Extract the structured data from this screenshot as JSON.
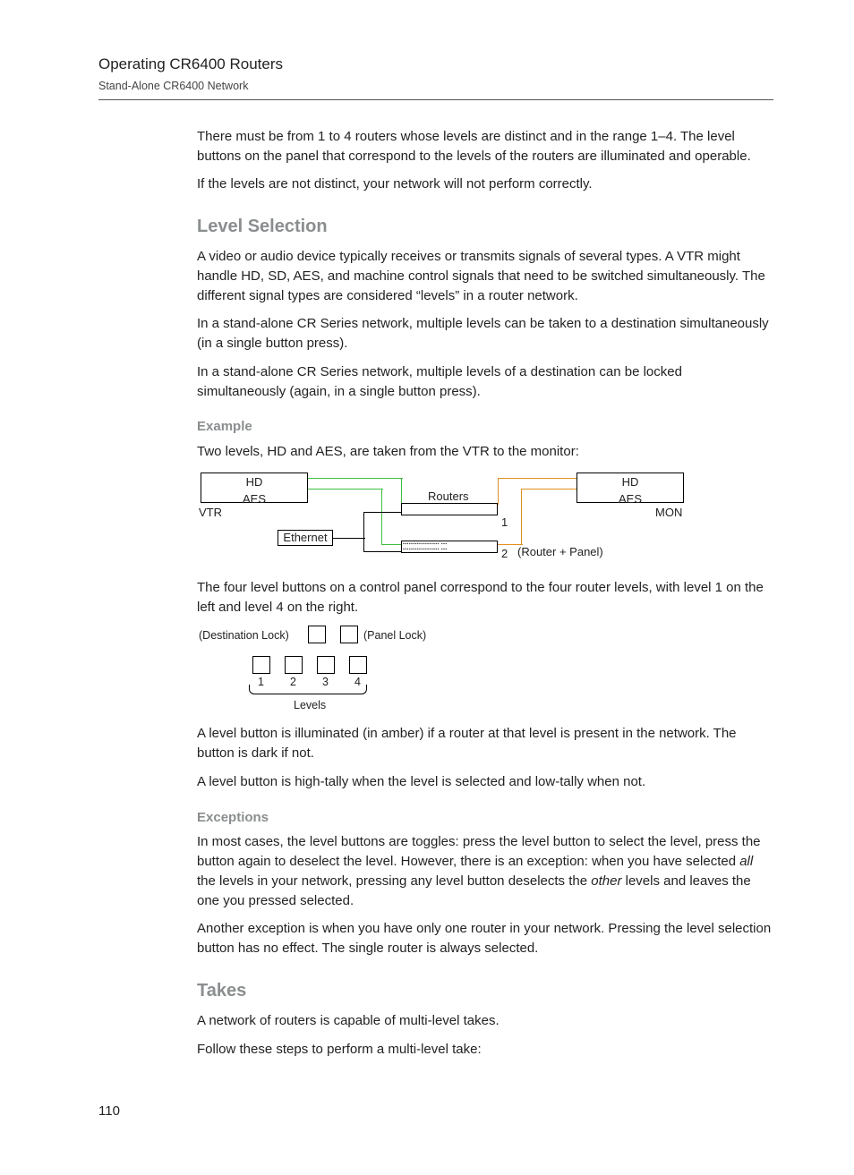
{
  "header": {
    "title": "Operating CR6400 Routers",
    "subtitle": "Stand-Alone CR6400 Network"
  },
  "intro": {
    "p1": "There must be from 1 to 4 routers whose levels are distinct and in the range 1–4. The level buttons on the panel that correspond to the levels of the routers are illuminated and operable.",
    "p2": "If the levels are not distinct, your network will not perform correctly."
  },
  "level_selection": {
    "heading": "Level Selection",
    "p1": "A video or audio device typically receives or transmits signals of several types. A VTR might handle HD, SD, AES, and machine control signals that need to be switched simultaneously. The different signal types are considered “levels” in a router network.",
    "p2": "In a stand-alone CR Series network, multiple levels can be taken to a destination simultaneously (in a single button press).",
    "p3": "In a stand-alone CR Series network, multiple levels of a destination can be locked simultaneously (again, in a single button press)."
  },
  "example": {
    "heading": "Example",
    "intro": "Two levels, HD and AES, are taken from the VTR to the monitor:",
    "diagram1": {
      "vtr_line1": "HD",
      "vtr_line2": "AES",
      "vtr_label": "VTR",
      "mon_line1": "HD",
      "mon_line2": "AES",
      "mon_label": "MON",
      "routers_label": "Routers",
      "ethernet_label": "Ethernet",
      "router_panel_label": "(Router + Panel)",
      "num1": "1",
      "num2": "2"
    },
    "after1": "The four level buttons on a control panel correspond to the four router levels, with level 1 on the left and level 4 on the right.",
    "diagram2": {
      "dest_lock": "(Destination Lock)",
      "panel_lock": "(Panel Lock)",
      "levels_label": "Levels",
      "n1": "1",
      "n2": "2",
      "n3": "3",
      "n4": "4"
    },
    "after2": "A level button is illuminated (in amber) if a router at that level is present in the network. The button is dark if not.",
    "after3": "A level button is high-tally when the level is selected and low-tally when not."
  },
  "exceptions": {
    "heading": "Exceptions",
    "p1a": "In most cases, the level buttons are toggles: press the level button to select the level, press the button again to deselect the level. However, there is an exception: when you have selected ",
    "p1_em1": "all",
    "p1b": " the levels in your network, pressing any level button deselects the ",
    "p1_em2": "other",
    "p1c": " levels and leaves the one you pressed selected.",
    "p2": "Another exception is when you have only one router in your network. Pressing the level selection button has no effect. The single router is always selected."
  },
  "takes": {
    "heading": "Takes",
    "p1": "A network of routers is capable of multi-level takes.",
    "p2": "Follow these steps to perform a multi-level take:"
  },
  "page_number": "110"
}
